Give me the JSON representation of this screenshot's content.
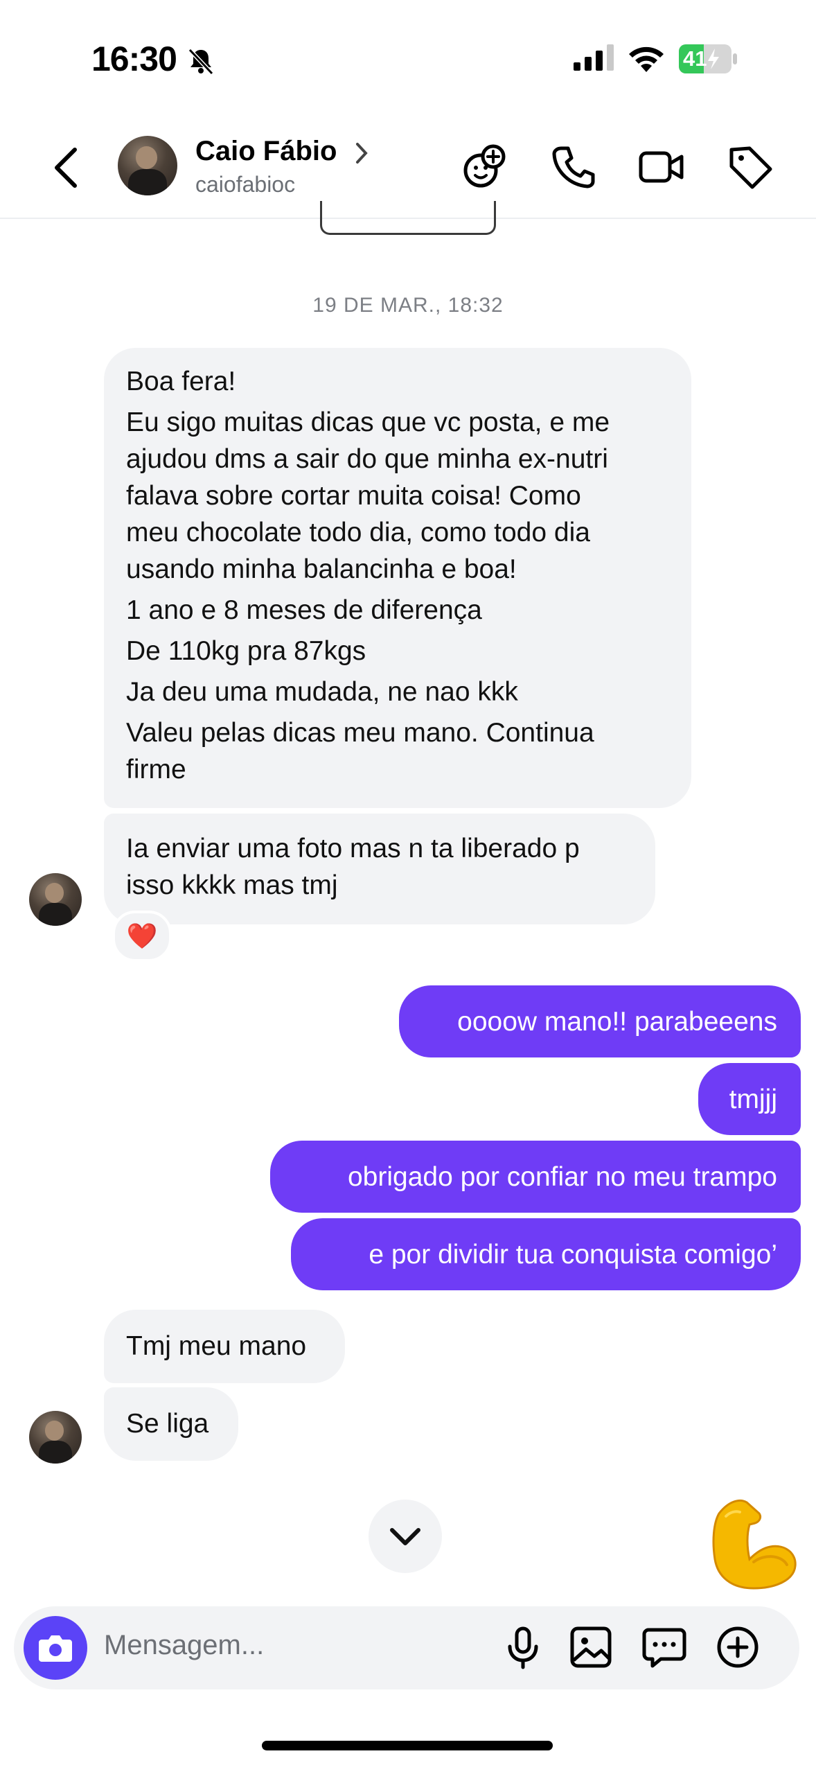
{
  "status_bar": {
    "time": "16:30",
    "battery": "41",
    "icons": [
      "bell-slash-icon",
      "signal-icon",
      "wifi-icon",
      "battery-charging-icon"
    ]
  },
  "header": {
    "contact_name": "Caio Fábio",
    "username": "caiofabioc",
    "actions": [
      "add-effects-icon",
      "phone-icon",
      "video-icon",
      "tag-icon"
    ]
  },
  "conversation": {
    "date_separator": "19 DE MAR., 18:32",
    "incoming_long": [
      "Boa fera!",
      "Eu sigo muitas dicas que vc posta, e me",
      "ajudou dms a sair do que minha ex-nutri",
      "falava sobre cortar muita coisa! Como",
      "meu chocolate todo dia, como todo dia",
      "usando minha balancinha e boa!",
      "1 ano e 8 meses de diferença",
      "De 110kg pra 87kgs",
      "Ja deu uma mudada, ne nao kkk",
      "Valeu pelas dicas meu mano. Continua",
      "firme"
    ],
    "incoming_photo": [
      "Ia enviar uma foto mas n ta liberado p",
      "isso kkkk mas tmj"
    ],
    "reaction": "❤️",
    "outgoing": [
      "oooow mano!! parabeeens",
      "tmjjj",
      "obrigado por confiar no meu trampo",
      "e por dividir tua conquista comigo’"
    ],
    "incoming_last": [
      "Tmj meu mano",
      "Se liga"
    ],
    "sticker": "flexed-biceps-emoji"
  },
  "composer": {
    "placeholder": "Mensagem...",
    "icons": [
      "camera-icon",
      "microphone-icon",
      "gallery-icon",
      "chat-icon",
      "plus-circle-icon"
    ]
  },
  "colors": {
    "outgoing_bubble": "#6f3cf6",
    "incoming_bubble": "#f2f3f5",
    "camera_button": "#5b43f7",
    "battery": "#34c759"
  }
}
